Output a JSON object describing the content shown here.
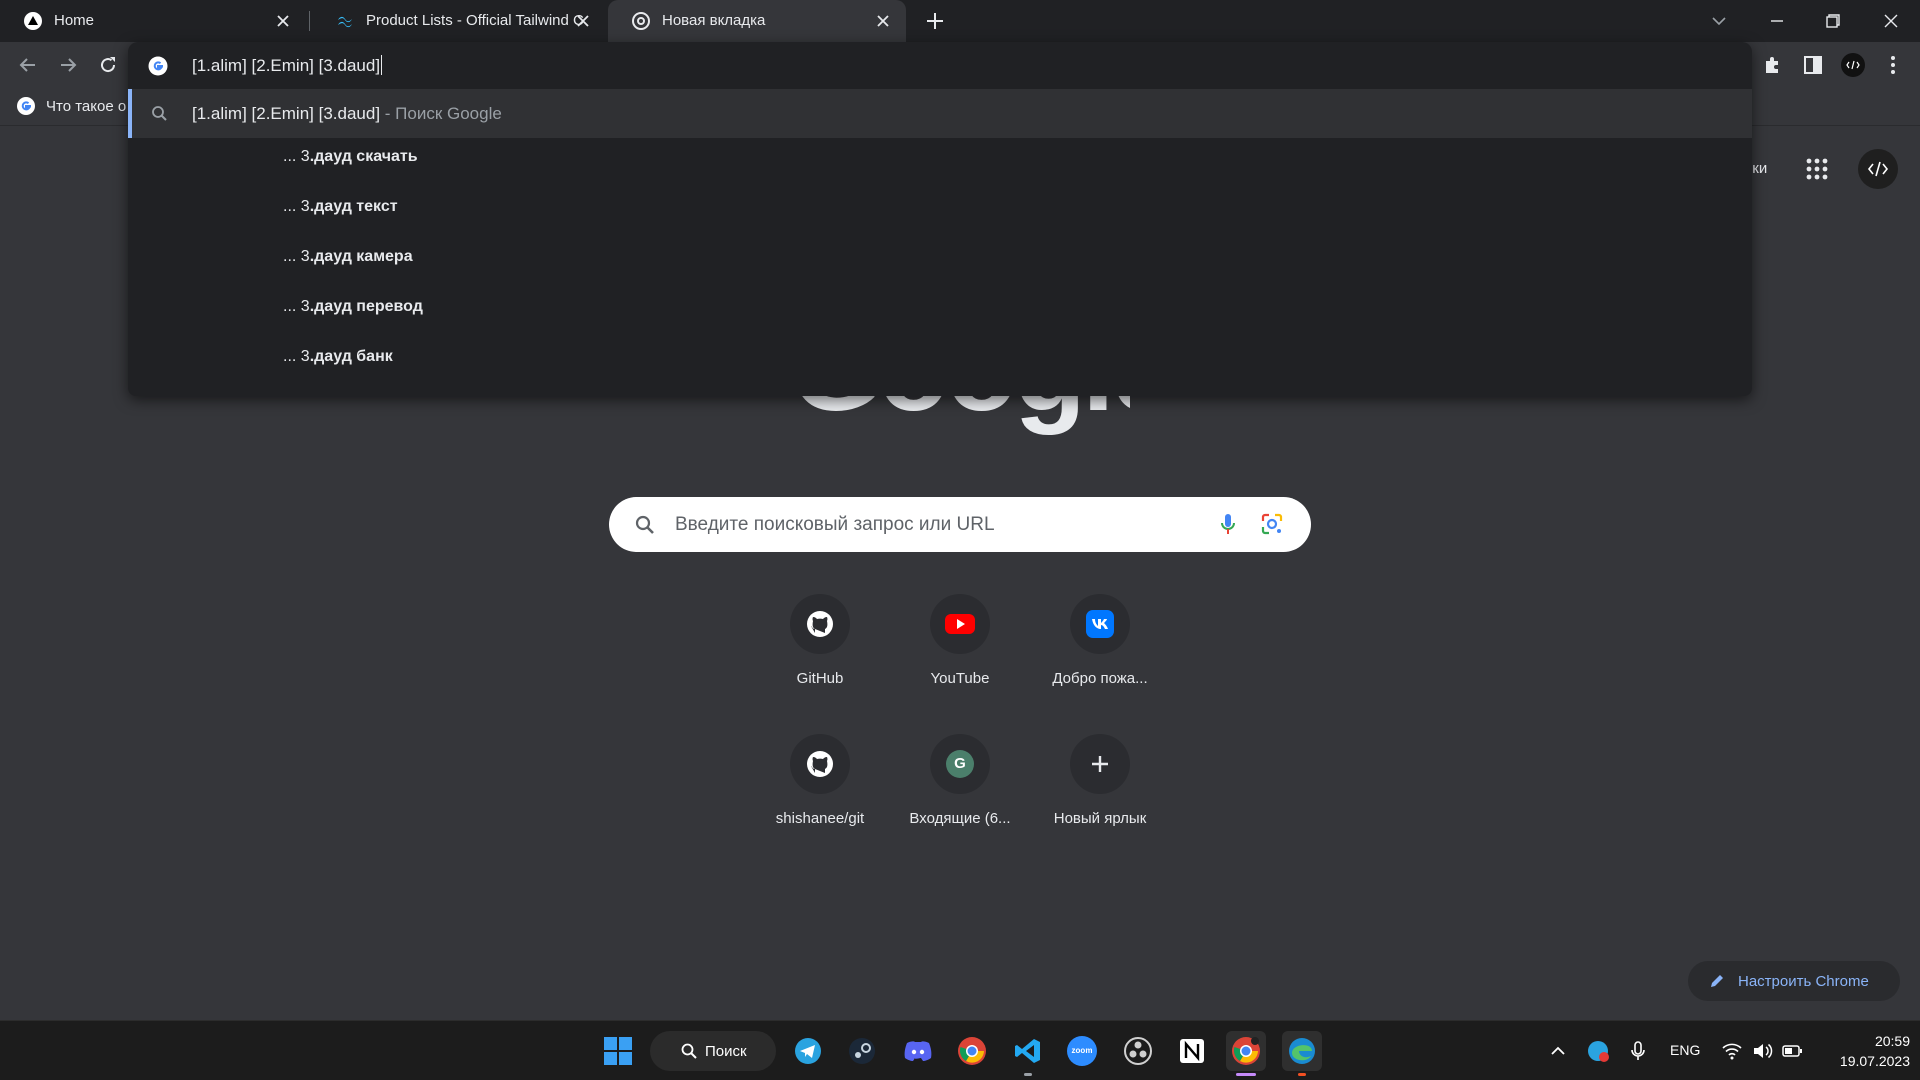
{
  "tabs": [
    {
      "title": "Home",
      "favicon": "triangle-logo-icon"
    },
    {
      "title": "Product Lists - Official Tailwind CSS",
      "favicon": "tailwind-icon"
    },
    {
      "title": "Новая вкладка",
      "favicon": "chrome-icon"
    }
  ],
  "omnibox": {
    "text": "[1.alim] [2.Emin] [3.daud]",
    "first_suggestion": "[1.alim] [2.Emin] [3.daud]",
    "first_suggestion_hint": "- Поиск Google",
    "suggestions": [
      {
        "prefix": "... 3",
        "bold": ".дауд скачать"
      },
      {
        "prefix": "... 3",
        "bold": ".дауд текст"
      },
      {
        "prefix": "... 3",
        "bold": ".дауд камера"
      },
      {
        "prefix": "... 3",
        "bold": ".дауд перевод"
      },
      {
        "prefix": "... 3",
        "bold": ".дауд банк"
      }
    ]
  },
  "bookmarks": [
    {
      "label": "Что такое о"
    }
  ],
  "ntp": {
    "logo": "Google",
    "topright_text": "нки",
    "search_placeholder": "Введите поисковый запрос или URL",
    "shortcuts": [
      {
        "label": "GitHub",
        "icon": "github-icon"
      },
      {
        "label": "YouTube",
        "icon": "youtube-icon"
      },
      {
        "label": "Добро пожа...",
        "icon": "vk-icon"
      },
      {
        "label": "shishanee/git",
        "icon": "github-icon"
      },
      {
        "label": "Входящие (6...",
        "icon": "letter-g-icon",
        "letter": "G"
      },
      {
        "label": "Новый ярлык",
        "icon": "plus-icon"
      }
    ],
    "customize_label": "Настроить Chrome"
  },
  "taskbar": {
    "search_label": "Поиск",
    "lang": "ENG",
    "time": "20:59",
    "date": "19.07.2023",
    "zoom_label": "zoom"
  }
}
